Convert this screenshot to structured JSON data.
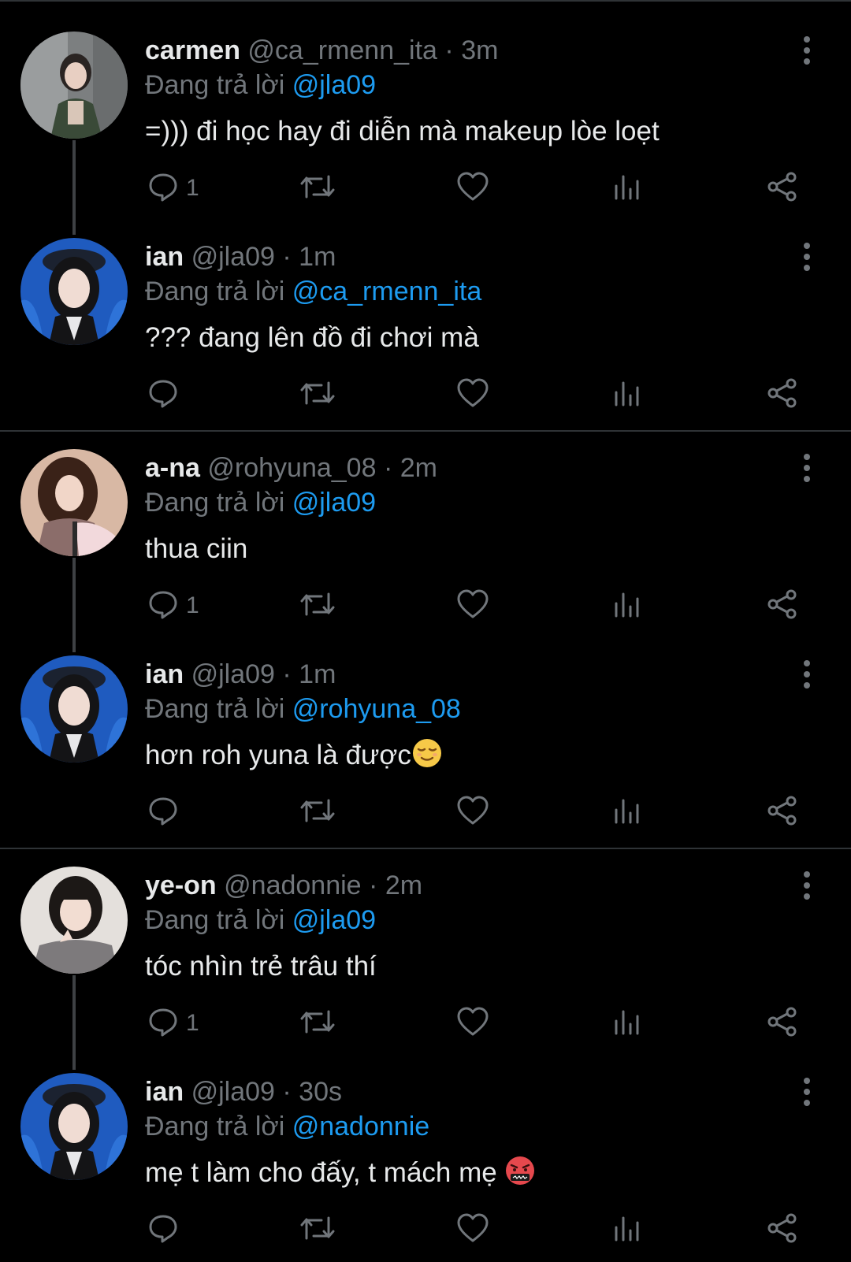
{
  "colors": {
    "background": "#000000",
    "text": "#e7e9ea",
    "secondary": "#71767b",
    "mention": "#1d9bf0",
    "divider": "#2f3336"
  },
  "labels": {
    "replying_to": "Đang trả lời"
  },
  "threads": [
    {
      "tweets": [
        {
          "name": "carmen",
          "handle": "@ca_rmenn_ita",
          "time": "3m",
          "reply_to": "@jla09",
          "text": "=))) đi học hay đi diễn mà makeup lòe loẹt",
          "reply_count": "1",
          "avatar": "avatar-carmen"
        },
        {
          "name": "ian",
          "handle": "@jla09",
          "time": "1m",
          "reply_to": "@ca_rmenn_ita",
          "text": "??? đang lên đồ đi chơi mà",
          "reply_count": "",
          "avatar": "avatar-ian"
        }
      ]
    },
    {
      "tweets": [
        {
          "name": "a-na",
          "handle": "@rohyuna_08",
          "time": "2m",
          "reply_to": "@jla09",
          "text": "thua ciin",
          "reply_count": "1",
          "avatar": "avatar-ana"
        },
        {
          "name": "ian",
          "handle": "@jla09",
          "time": "1m",
          "reply_to": "@rohyuna_08",
          "text": "hơn roh yuna là được",
          "emoji": "relieved-face-emoji",
          "reply_count": "",
          "avatar": "avatar-ian"
        }
      ]
    },
    {
      "tweets": [
        {
          "name": "ye-on",
          "handle": "@nadonnie",
          "time": "2m",
          "reply_to": "@jla09",
          "text": "tóc nhìn trẻ trâu thí",
          "reply_count": "1",
          "avatar": "avatar-yeon"
        },
        {
          "name": "ian",
          "handle": "@jla09",
          "time": "30s",
          "reply_to": "@nadonnie",
          "text": "mẹ t làm cho đấy, t mách mẹ ",
          "emoji": "cursing-face-emoji",
          "reply_count": "",
          "avatar": "avatar-ian"
        }
      ]
    }
  ],
  "icons": [
    "reply-icon",
    "retweet-icon",
    "like-icon",
    "views-icon",
    "share-icon",
    "more-icon"
  ]
}
